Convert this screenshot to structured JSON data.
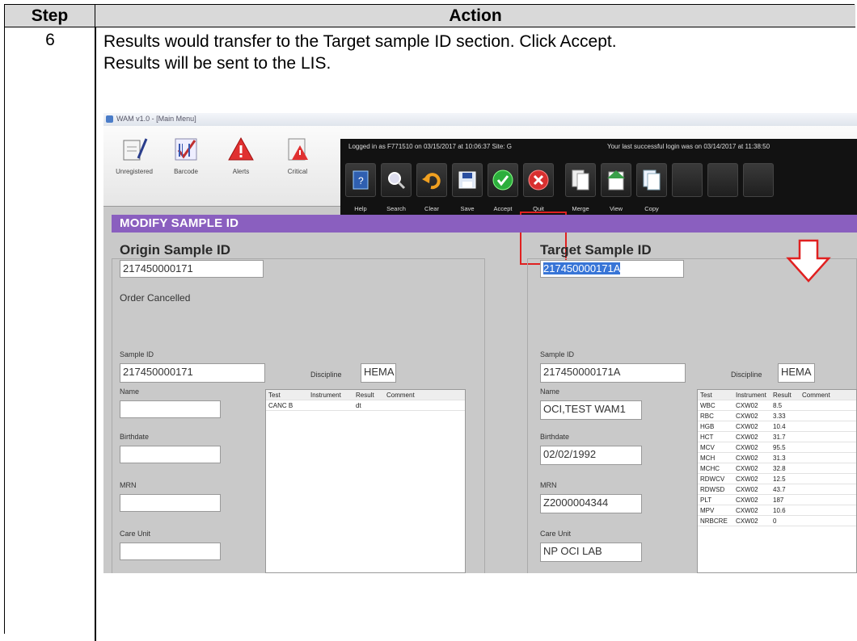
{
  "table": {
    "header_step": "Step",
    "header_action": "Action",
    "step_number": "6",
    "instruction_line1": "Results would transfer to the Target sample ID section. Click Accept.",
    "instruction_line2": "Results will be sent to the LIS."
  },
  "screenshot": {
    "window_title": "WAM v1.0 - [Main Menu]",
    "nav_buttons": [
      "Unregistered",
      "Barcode",
      "Alerts",
      "Critical"
    ],
    "status_left": "Logged in as F771510 on 03/15/2017 at 10:06:37   Site: G",
    "status_right": "Your last successful login was on 03/14/2017 at 11:38:50",
    "toolbar": [
      "Help",
      "Search",
      "Clear",
      "Save",
      "Accept",
      "Quit",
      "Merge",
      "View",
      "Copy"
    ],
    "section_bar": "MODIFY SAMPLE ID",
    "origin": {
      "title": "Origin Sample ID",
      "id_value": "217450000171",
      "note": "Order Cancelled",
      "sample_id_label": "Sample ID",
      "sample_id_value": "217450000171",
      "discipline_label": "Discipline",
      "discipline_value": "HEMA",
      "name_label": "Name",
      "name_value": "",
      "birthdate_label": "Birthdate",
      "birthdate_value": "",
      "mrn_label": "MRN",
      "mrn_value": "",
      "care_unit_label": "Care Unit",
      "care_unit_value": "",
      "results_headers": [
        "Test",
        "Instrument",
        "Result",
        "Comment"
      ],
      "results_rows": [
        [
          "CANC B",
          "",
          "dt",
          ""
        ]
      ]
    },
    "target": {
      "title": "Target Sample ID",
      "id_value": "217450000171A",
      "sample_id_label": "Sample ID",
      "sample_id_value": "217450000171A",
      "discipline_label": "Discipline",
      "discipline_value": "HEMA",
      "name_label": "Name",
      "name_value": "OCI,TEST WAM1",
      "birthdate_label": "Birthdate",
      "birthdate_value": "02/02/1992",
      "mrn_label": "MRN",
      "mrn_value": "Z2000004344",
      "care_unit_label": "Care Unit",
      "care_unit_value": "NP OCI LAB",
      "results_headers": [
        "Test",
        "Instrument",
        "Result",
        "Comment"
      ],
      "results_rows": [
        [
          "WBC",
          "CXW02",
          "8.5",
          ""
        ],
        [
          "RBC",
          "CXW02",
          "3.33",
          ""
        ],
        [
          "HGB",
          "CXW02",
          "10.4",
          ""
        ],
        [
          "HCT",
          "CXW02",
          "31.7",
          ""
        ],
        [
          "MCV",
          "CXW02",
          "95.5",
          ""
        ],
        [
          "MCH",
          "CXW02",
          "31.3",
          ""
        ],
        [
          "MCHC",
          "CXW02",
          "32.8",
          ""
        ],
        [
          "RDWCV",
          "CXW02",
          "12.5",
          ""
        ],
        [
          "RDWSD",
          "CXW02",
          "43.7",
          ""
        ],
        [
          "PLT",
          "CXW02",
          "187",
          ""
        ],
        [
          "MPV",
          "CXW02",
          "10.6",
          ""
        ],
        [
          "NRBCRE",
          "CXW02",
          "0",
          ""
        ]
      ]
    },
    "colors": {
      "section_bar": "#8a5fbf",
      "accept_highlight": "#e02020",
      "arrow": "#e02020",
      "selection": "#3875d7"
    }
  }
}
